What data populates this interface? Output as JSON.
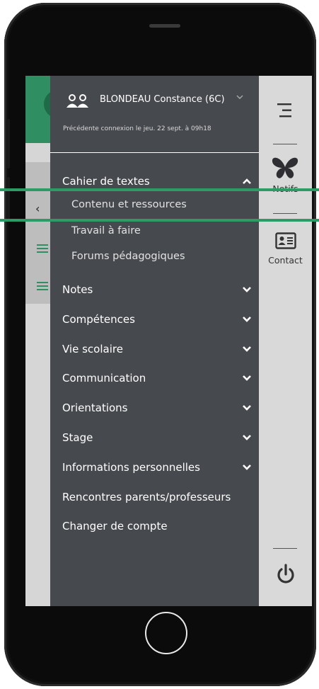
{
  "profile": {
    "name": "BLONDEAU Constance (6C)",
    "last_login": "Précédente connexion le jeu. 22 sept. à 09h18"
  },
  "menu": {
    "cahier": "Cahier de textes",
    "sub": [
      "Contenu et ressources",
      "Travail à faire",
      "Forums pédagogiques"
    ],
    "notes": "Notes",
    "competences": "Compétences",
    "vie_scolaire": "Vie scolaire",
    "communication": "Communication",
    "orientations": "Orientations",
    "stage": "Stage",
    "infos": "Informations personnelles",
    "rencontres": "Rencontres parents/professeurs",
    "changer": "Changer de compte"
  },
  "rail": {
    "notifs_label": "Notifs",
    "contact_label": "Contact"
  },
  "colors": {
    "drawer_bg": "#46494e",
    "accent_green": "#2e9a66",
    "rail_bg": "#d9d9d9"
  }
}
